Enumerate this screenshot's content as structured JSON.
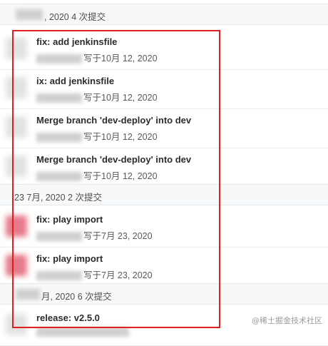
{
  "groups": [
    {
      "header": ", 2020 4 次提交"
    },
    {
      "header": "23 7月, 2020 2 次提交"
    },
    {
      "header": "月, 2020 6 次提交"
    }
  ],
  "commits": [
    {
      "title": "fix: add jenkinsfile",
      "meta": "写于10月 12, 2020"
    },
    {
      "title": "ix: add jenkinsfile",
      "meta": "写于10月 12, 2020"
    },
    {
      "title": "Merge branch 'dev-deploy' into dev",
      "meta": "写于10月 12, 2020"
    },
    {
      "title": "Merge branch 'dev-deploy' into dev",
      "meta": "写于10月 12, 2020"
    },
    {
      "title": "fix: play import",
      "meta": "写于7月 23, 2020"
    },
    {
      "title": "fix: play import",
      "meta": "写于7月 23, 2020"
    },
    {
      "title": "release: v2.5.0",
      "meta": ""
    }
  ],
  "watermark": "@稀土掘金技术社区",
  "colors": {
    "highlight": "#e0201a",
    "header_bg": "#f6f8fa"
  }
}
